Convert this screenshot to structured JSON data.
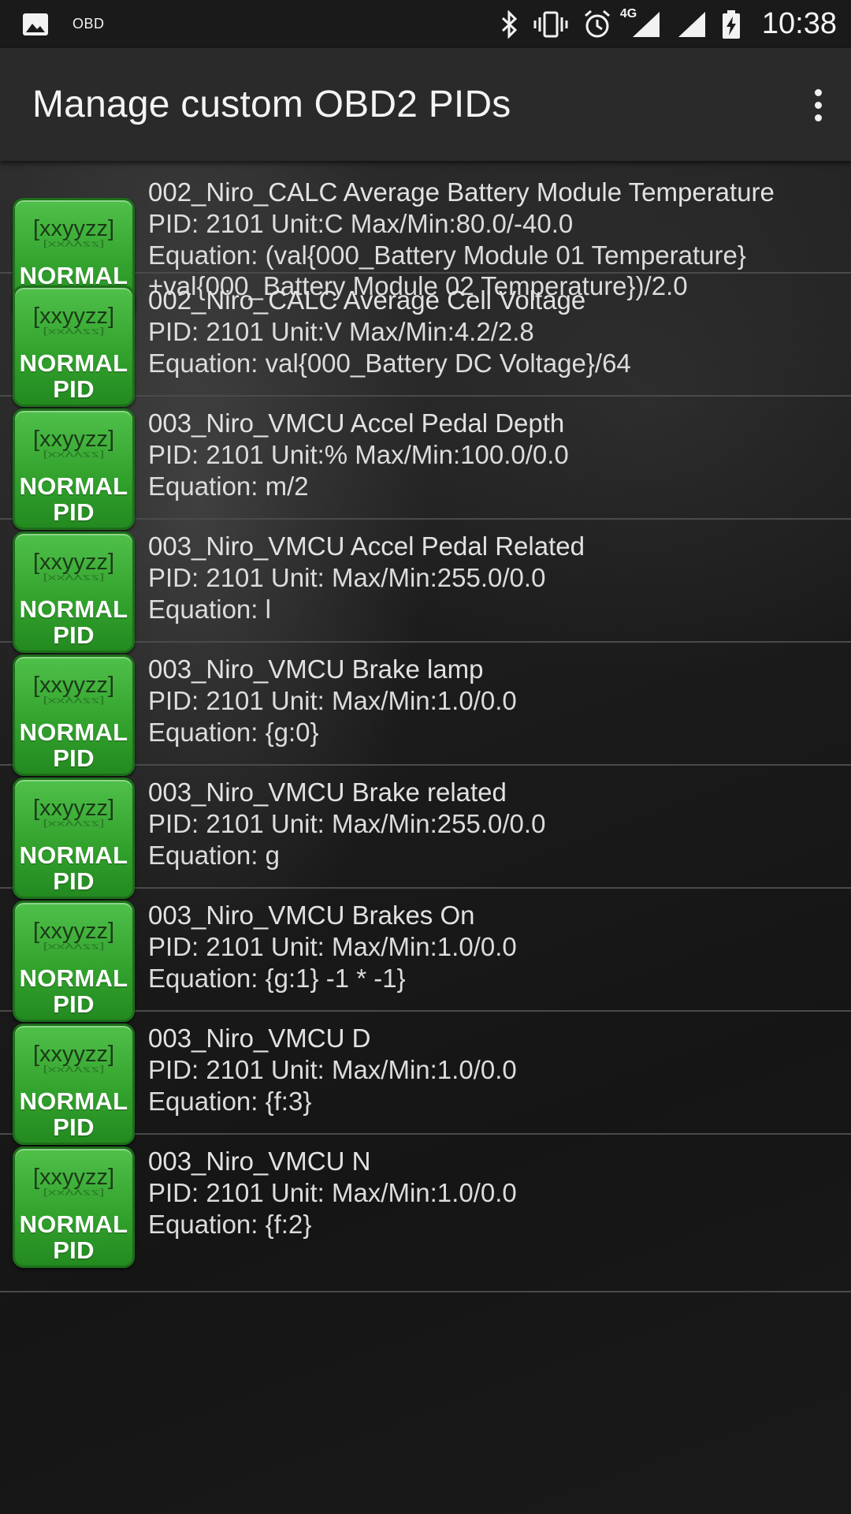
{
  "status_bar": {
    "app_label": "OBD",
    "network_label": "4G",
    "time": "10:38"
  },
  "app_bar": {
    "title": "Manage custom OBD2 PIDs"
  },
  "badge": {
    "code": "[xxyyzz]",
    "line1": "NORMAL",
    "line2": "PID"
  },
  "items": [
    {
      "name": "002_Niro_CALC Average Battery Module Temperature",
      "details": "PID: 2101  Unit:C Max/Min:80.0/-40.0",
      "equation": "Equation: (val{000_Battery Module 01 Temperature}",
      "equation_cont": "+val{000_Battery Module 02 Temperature})/2.0"
    },
    {
      "name": "002_Niro_CALC Average Cell Voltage",
      "details": "PID: 2101  Unit:V Max/Min:4.2/2.8",
      "equation": "Equation: val{000_Battery DC Voltage}/64"
    },
    {
      "name": "003_Niro_VMCU Accel Pedal Depth",
      "details": "PID: 2101  Unit:% Max/Min:100.0/0.0",
      "equation": "Equation: m/2"
    },
    {
      "name": "003_Niro_VMCU Accel Pedal Related",
      "details": "PID: 2101  Unit: Max/Min:255.0/0.0",
      "equation": "Equation: l"
    },
    {
      "name": "003_Niro_VMCU Brake lamp",
      "details": "PID: 2101  Unit: Max/Min:1.0/0.0",
      "equation": "Equation: {g:0}"
    },
    {
      "name": "003_Niro_VMCU Brake related",
      "details": "PID: 2101  Unit: Max/Min:255.0/0.0",
      "equation": "Equation: g"
    },
    {
      "name": "003_Niro_VMCU Brakes On",
      "details": "PID: 2101  Unit: Max/Min:1.0/0.0",
      "equation": "Equation: {g:1} -1 * -1}"
    },
    {
      "name": "003_Niro_VMCU D",
      "details": "PID: 2101  Unit: Max/Min:1.0/0.0",
      "equation": "Equation: {f:3}"
    },
    {
      "name": "003_Niro_VMCU N",
      "details": "PID: 2101  Unit: Max/Min:1.0/0.0",
      "equation": "Equation: {f:2}"
    }
  ]
}
